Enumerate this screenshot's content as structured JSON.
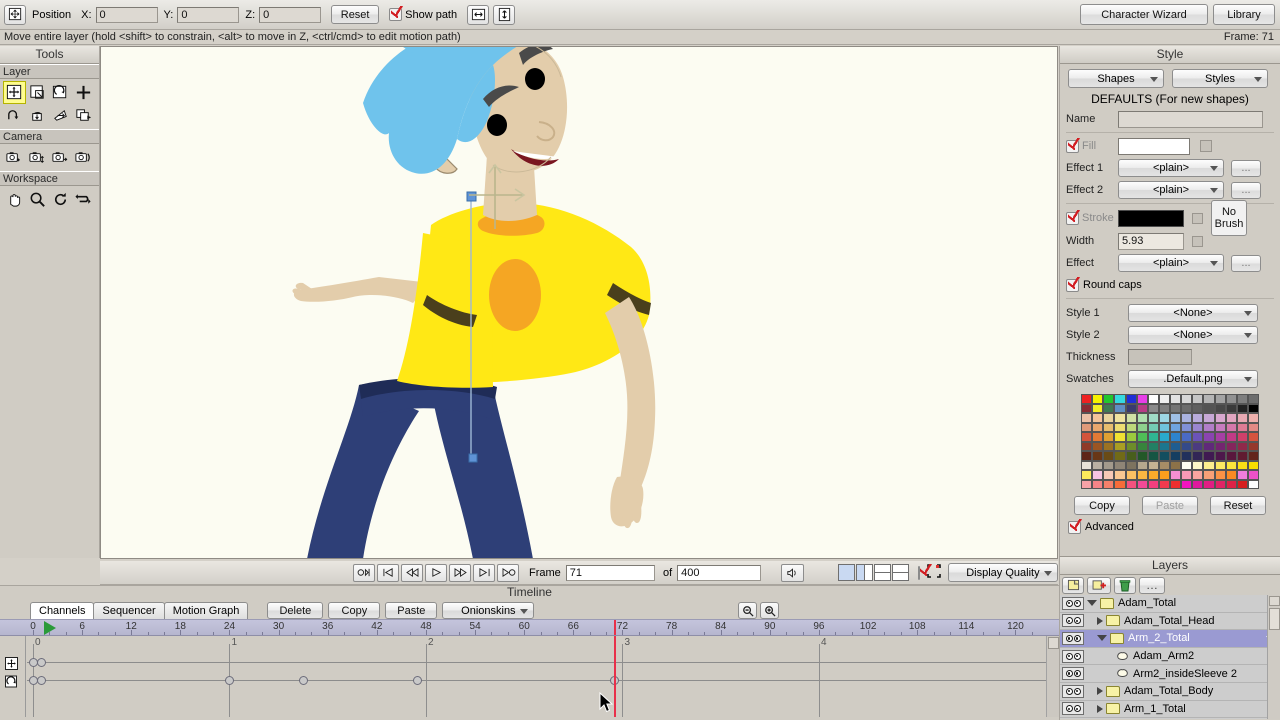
{
  "toolbar": {
    "move_layer_icon": "move-layer-icon",
    "position_label": "Position",
    "x_label": "X:",
    "x_value": "0",
    "y_label": "Y:",
    "y_value": "0",
    "z_label": "Z:",
    "z_value": "0",
    "reset_label": "Reset",
    "show_path_label": "Show path",
    "show_path_checked": true,
    "flip_h_icon": "flip-horizontal-icon",
    "flip_v_icon": "flip-vertical-icon",
    "character_wizard_label": "Character Wizard",
    "library_label": "Library"
  },
  "status": {
    "hint": "Move entire layer (hold <shift> to constrain, <alt> to move in Z, <ctrl/cmd> to edit motion path)",
    "frame_indicator": "Frame: 71"
  },
  "tools": {
    "title": "Tools",
    "sections": [
      {
        "label": "Layer",
        "items": [
          {
            "name": "translate-layer-tool",
            "selected": true
          },
          {
            "name": "scale-layer-tool",
            "selected": false
          },
          {
            "name": "rotate-layer-tool",
            "selected": false
          },
          {
            "name": "add-point-tool",
            "selected": false
          },
          {
            "name": "rotate-layer-z-tool",
            "selected": false
          },
          {
            "name": "shear-layer-y-tool",
            "selected": false
          },
          {
            "name": "shear-layer-x-tool",
            "selected": false
          },
          {
            "name": "set-origin-tool",
            "selected": false
          }
        ]
      },
      {
        "label": "Camera",
        "items": [
          {
            "name": "track-camera-tool",
            "selected": false
          },
          {
            "name": "zoom-camera-tool",
            "selected": false
          },
          {
            "name": "roll-camera-tool",
            "selected": false
          },
          {
            "name": "pan-tilt-camera-tool",
            "selected": false
          }
        ]
      },
      {
        "label": "Workspace",
        "items": [
          {
            "name": "pan-workspace-tool",
            "selected": false
          },
          {
            "name": "zoom-workspace-tool",
            "selected": false
          },
          {
            "name": "rotate-workspace-tool",
            "selected": false
          },
          {
            "name": "orbit-workspace-tool",
            "selected": false
          }
        ]
      }
    ]
  },
  "canvas": {
    "background_color": "#fcfcf2",
    "character": {
      "name": "Adam",
      "hair_color": "#6fc3ec",
      "skin_color": "#e3cdab",
      "shirt_color": "#ffe815",
      "shirt_accent_color": "#f5a623",
      "pants_color": "#2e3f77",
      "sleeve_shadow_color": "#4a3f1c",
      "eye_color": "#000000",
      "mouth_color": "#7a1620"
    },
    "selection_handle_color": "#5f93d6"
  },
  "playback": {
    "buttons": [
      {
        "name": "rewind-to-start-button",
        "glyph": "◁|"
      },
      {
        "name": "previous-keyframe-button",
        "glyph": "|◁"
      },
      {
        "name": "step-back-button",
        "glyph": "◁◁"
      },
      {
        "name": "play-button",
        "glyph": "▷"
      },
      {
        "name": "step-forward-button",
        "glyph": "▷▷"
      },
      {
        "name": "next-keyframe-button",
        "glyph": "▷|"
      },
      {
        "name": "go-to-end-button",
        "glyph": "▷○"
      }
    ],
    "frame_label": "Frame",
    "frame_value": "71",
    "of_label": "of",
    "total_frames": "400",
    "audio_icon": "speaker-icon",
    "view_layouts": [
      "single-view",
      "two-column-view",
      "two-row-view",
      "quad-view"
    ],
    "enable_checkbox_checked": true,
    "select_bounds_icon": "select-bounds-icon",
    "display_quality_label": "Display Quality"
  },
  "style": {
    "title": "Style",
    "shapes_label": "Shapes",
    "styles_label": "Styles",
    "defaults_label": "DEFAULTS (For new shapes)",
    "name_label": "Name",
    "name_value": "",
    "fill_label": "Fill",
    "fill_checked": true,
    "fill_color": "#ffffff",
    "effect1_label": "Effect 1",
    "effect1_value": "<plain>",
    "effect2_label": "Effect 2",
    "effect2_value": "<plain>",
    "ellipsis_label": "...",
    "stroke_label": "Stroke",
    "stroke_checked": true,
    "stroke_color": "#000000",
    "no_brush_label": "No Brush",
    "width_label": "Width",
    "width_value": "5.93",
    "effect_label": "Effect",
    "effect_value": "<plain>",
    "round_caps_label": "Round caps",
    "round_caps_checked": true,
    "style1_label": "Style 1",
    "style1_value": "<None>",
    "style2_label": "Style 2",
    "style2_value": "<None>",
    "thickness_label": "Thickness",
    "thickness_value": "",
    "swatches_label": "Swatches",
    "swatches_value": ".Default.png",
    "copy_label": "Copy",
    "paste_label": "Paste",
    "paste_disabled": true,
    "reset_label": "Reset",
    "advanced_label": "Advanced",
    "advanced_checked": true,
    "swatch_rows": [
      [
        "#ee2222",
        "#f7f200",
        "#22c72e",
        "#35d9e0",
        "#1f2fd6",
        "#e83fe8",
        "#ffffff",
        "#efefef",
        "#e2e2e2",
        "#d6d6d6",
        "#c6c6c6",
        "#b5b5b5",
        "#a3a3a3",
        "#919191",
        "#7e7e7e",
        "#6d6d6d"
      ],
      [
        "#8a2b33",
        "#f4ef26",
        "#3e7b52",
        "#5f8fc4",
        "#3a3a6e",
        "#b83b86",
        "#8a8a8a",
        "#7f7f7f",
        "#757575",
        "#6b6b6b",
        "#5f5f5f",
        "#535353",
        "#474747",
        "#3a3a3a",
        "#222222",
        "#000000"
      ],
      [
        "#ecc1a8",
        "#f2c49a",
        "#e8d39d",
        "#eee3a0",
        "#cfe0a5",
        "#aedfae",
        "#9fdcc6",
        "#9cd6e4",
        "#9fc0e6",
        "#a9b2e0",
        "#b8abdb",
        "#c7a8d6",
        "#d8a8cf",
        "#e2a6c1",
        "#e8a9b3",
        "#eeb0ad"
      ],
      [
        "#e09a7a",
        "#eaa86e",
        "#e6bd6f",
        "#eddd72",
        "#bdd97b",
        "#8ed18e",
        "#74cdb4",
        "#6fc3dd",
        "#6fa4e0",
        "#8090d8",
        "#9a86cf",
        "#b17ec8",
        "#c67cc0",
        "#d478ab",
        "#de7c95",
        "#e38a85"
      ],
      [
        "#d3543c",
        "#e27a35",
        "#e0a033",
        "#f0e133",
        "#9cc93e",
        "#4fbd57",
        "#2fb592",
        "#29a9cd",
        "#2d84cf",
        "#4a6ac5",
        "#6b53b8",
        "#8a44b0",
        "#a63fa4",
        "#c13a86",
        "#d0406a",
        "#d6543f"
      ],
      [
        "#8f3a28",
        "#9b5523",
        "#9c7222",
        "#a99e23",
        "#6d8d2a",
        "#37843c",
        "#228064",
        "#1c768e",
        "#1f5d91",
        "#344a89",
        "#4b3a80",
        "#60297a",
        "#742570",
        "#85255c",
        "#90294a",
        "#95382c"
      ],
      [
        "#5e2418",
        "#683716",
        "#694b16",
        "#716a17",
        "#485e1c",
        "#235828",
        "#155543",
        "#134e5f",
        "#153e61",
        "#22315c",
        "#322656",
        "#401a52",
        "#4d174b",
        "#59173d",
        "#601b31",
        "#63251d"
      ],
      [
        "#e7e2d8",
        "#b9b0a3",
        "#a39a8c",
        "#8f8576",
        "#7d735f",
        "#b6a88e",
        "#c5b293",
        "#a68c66",
        "#8c7248",
        "#fefef2",
        "#fdf8c8",
        "#fdf08e",
        "#fcea62",
        "#fbe63b",
        "#fae015",
        "#f7dd00"
      ],
      [
        "#fcea5b",
        "#f7c4e2",
        "#f6c9b6",
        "#f9c892",
        "#fbc063",
        "#fbb742",
        "#fbaa2a",
        "#fb9e1e",
        "#f78fd0",
        "#f79ab6",
        "#f8a5a0",
        "#f8a077",
        "#fa9246",
        "#fb8a24",
        "#f07edb",
        "#ee52c8"
      ],
      [
        "#f7a2a7",
        "#f58487",
        "#f4806a",
        "#f66c39",
        "#f5527f",
        "#f34a97",
        "#f23f7e",
        "#f13a4e",
        "#ee2f2f",
        "#f214c0",
        "#e0199d",
        "#e01e83",
        "#e02466",
        "#dd2247",
        "#d71f1f",
        "#fefefe"
      ]
    ]
  },
  "layers": {
    "title": "Layers",
    "tools": [
      {
        "name": "new-layer-button",
        "icon": "new-layer-icon"
      },
      {
        "name": "duplicate-layer-button",
        "icon": "duplicate-layer-icon"
      },
      {
        "name": "delete-layer-button",
        "icon": "trash-icon"
      },
      {
        "name": "layer-options-button",
        "icon": "ellipsis-icon"
      }
    ],
    "items": [
      {
        "name": "Adam_Total",
        "type": "folder",
        "depth": 0,
        "expanded": true,
        "selected": false,
        "visible": true
      },
      {
        "name": "Adam_Total_Head",
        "type": "folder",
        "depth": 1,
        "expanded": false,
        "selected": false,
        "visible": true
      },
      {
        "name": "Arm_2_Total",
        "type": "folder",
        "depth": 1,
        "expanded": true,
        "selected": true,
        "visible": true
      },
      {
        "name": "Adam_Arm2",
        "type": "vector",
        "depth": 2,
        "expanded": false,
        "selected": false,
        "visible": true
      },
      {
        "name": "Arm2_insideSleeve 2",
        "type": "vector",
        "depth": 2,
        "expanded": false,
        "selected": false,
        "visible": true
      },
      {
        "name": "Adam_Total_Body",
        "type": "folder",
        "depth": 1,
        "expanded": false,
        "selected": false,
        "visible": true
      },
      {
        "name": "Arm_1_Total",
        "type": "folder",
        "depth": 1,
        "expanded": false,
        "selected": false,
        "visible": true
      }
    ]
  },
  "timeline": {
    "title": "Timeline",
    "tabs": [
      {
        "label": "Channels",
        "active": true
      },
      {
        "label": "Sequencer",
        "active": false
      },
      {
        "label": "Motion Graph",
        "active": false
      }
    ],
    "buttons": [
      {
        "label": "Delete",
        "name": "delete-keyframes-button"
      },
      {
        "label": "Copy",
        "name": "copy-keyframes-button"
      },
      {
        "label": "Paste",
        "name": "paste-keyframes-button"
      }
    ],
    "onionskins_label": "Onionskins",
    "zoom_out_icon": "zoom-out-icon",
    "zoom_in_icon": "zoom-in-icon",
    "ruler_start": 0,
    "ruler_end": 123,
    "ruler_ticks": [
      0,
      6,
      12,
      18,
      24,
      30,
      36,
      42,
      48,
      54,
      60,
      66,
      72,
      78,
      84,
      90,
      96,
      102,
      108,
      114,
      120
    ],
    "current_frame": 71,
    "second_marks": [
      {
        "label": "0",
        "frame": 0
      },
      {
        "label": "1",
        "frame": 24
      },
      {
        "label": "2",
        "frame": 48
      },
      {
        "label": "3",
        "frame": 72
      },
      {
        "label": "4",
        "frame": 96
      }
    ],
    "channels": [
      {
        "name": "layer-translation-channel",
        "icon": "move-layer-icon",
        "keyframes": [
          0,
          1
        ]
      },
      {
        "name": "layer-rotation-channel",
        "icon": "rotate-layer-icon",
        "keyframes": [
          0,
          1,
          24,
          33,
          47,
          71
        ]
      }
    ]
  }
}
